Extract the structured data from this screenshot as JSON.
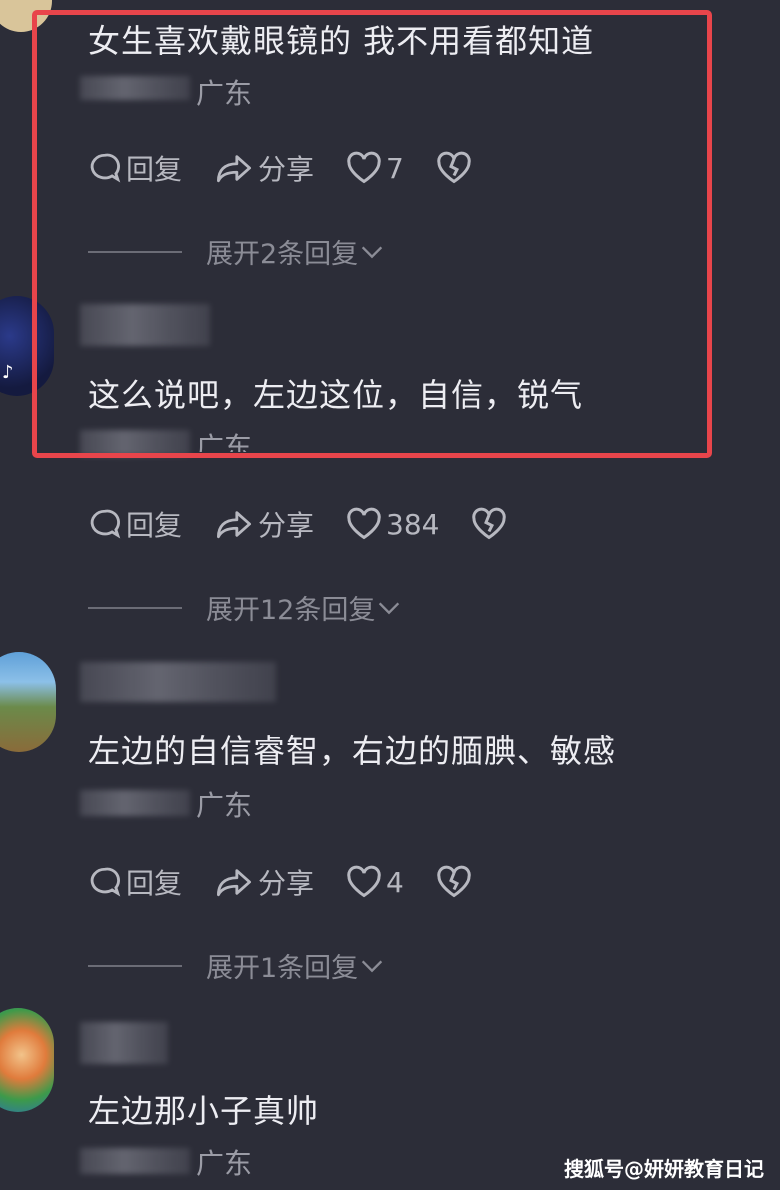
{
  "comments": [
    {
      "text": "女生喜欢戴眼镜的  我不用看都知道",
      "location": "广东",
      "actions": {
        "reply": "回复",
        "share": "分享",
        "likes": "7"
      },
      "expand": "展开2条回复"
    },
    {
      "text": "这么说吧，左边这位，自信，锐气",
      "location": "广东",
      "actions": {
        "reply": "回复",
        "share": "分享",
        "likes": "384"
      },
      "expand": "展开12条回复"
    },
    {
      "text": "左边的自信睿智，右边的腼腆、敏感",
      "location": "广东",
      "actions": {
        "reply": "回复",
        "share": "分享",
        "likes": "4"
      },
      "expand": "展开1条回复"
    },
    {
      "text": "左边那小子真帅",
      "location": "广东"
    }
  ],
  "watermark": "搜狐号@妍妍教育日记",
  "colors": {
    "background": "#2c2d38",
    "highlight": "#e8454b"
  }
}
